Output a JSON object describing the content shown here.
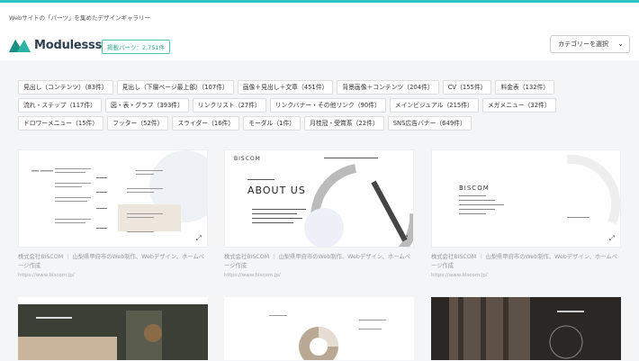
{
  "header": {
    "tagline": "Webサイトの「パーツ」を集めたデザインギャラリー",
    "logo_text": "Modulesss...",
    "badge": "掲載パーツ：2,751件",
    "category_select": "カテゴリーを選択"
  },
  "tags": [
    [
      "見出し（コンテンツ）（83件）",
      "見出し（下層ページ最上部）（107件）",
      "画像＋見出し＋文章（451件）",
      "背景画像＋コンテンツ（204件）",
      "CV（155件）",
      "料金表（132件）"
    ],
    [
      "流れ・ステップ（117件）",
      "図・表・グラフ（393件）",
      "リンクリスト（27件）",
      "リンクバナー・その他リンク（90件）",
      "メインビジュアル（215件）",
      "メガメニュー（32件）"
    ],
    [
      "ドロワーメニュー（15件）",
      "フッター（52件）",
      "スライダー（16件）",
      "モーダル（1件）",
      "月桂冠・受賞系（22件）",
      "SNS広告バナー（649件）"
    ]
  ],
  "cards": [
    {
      "caption": "株式会社BISCOM ｜ 山梨県甲府市のWeb制作、Webデザイン、ホームページ作成",
      "url": "https://www.biscom.jp/"
    },
    {
      "caption": "株式会社BISCOM ｜ 山梨県甲府市のWeb制作、Webデザイン、ホームページ作成",
      "url": "https://www.biscom.jp/",
      "thumb_brand": "BISCOM",
      "thumb_title": "ABOUT US"
    },
    {
      "caption": "株式会社BISCOM ｜ 山梨県甲府市のWeb制作、Webデザイン、ホームページ作成",
      "url": "https://www.biscom.jp/",
      "thumb_brand": "BISCOM"
    }
  ],
  "colors": {
    "accent": "#2bc3c3",
    "badge": "#2faa8e"
  }
}
